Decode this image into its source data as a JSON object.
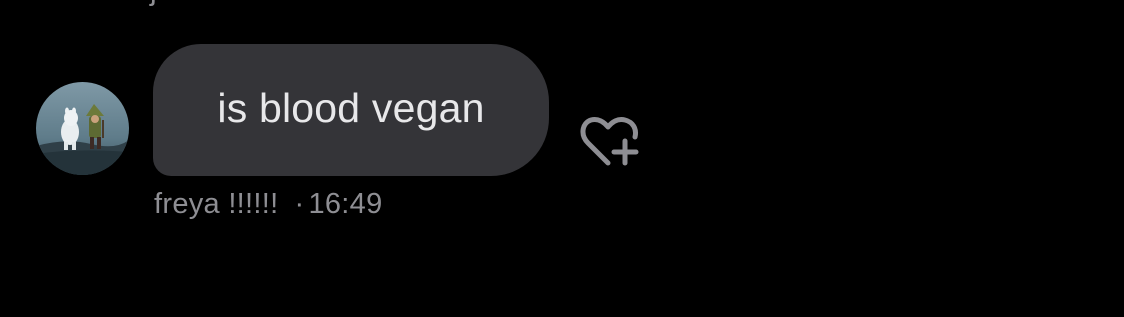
{
  "conversation": {
    "previous_fragment": "j",
    "message": {
      "text": "is blood vegan",
      "sender_name": "freya !!!!!!",
      "separator": "·",
      "time": "16:49",
      "avatar_icon": "moomin-avatar-icon",
      "react_icon": "heart-plus-icon"
    }
  },
  "colors": {
    "background": "#000000",
    "bubble": "#343438",
    "message_text": "#e8e8ea",
    "meta_text": "#8e8e93",
    "icon": "#8e8e93"
  }
}
